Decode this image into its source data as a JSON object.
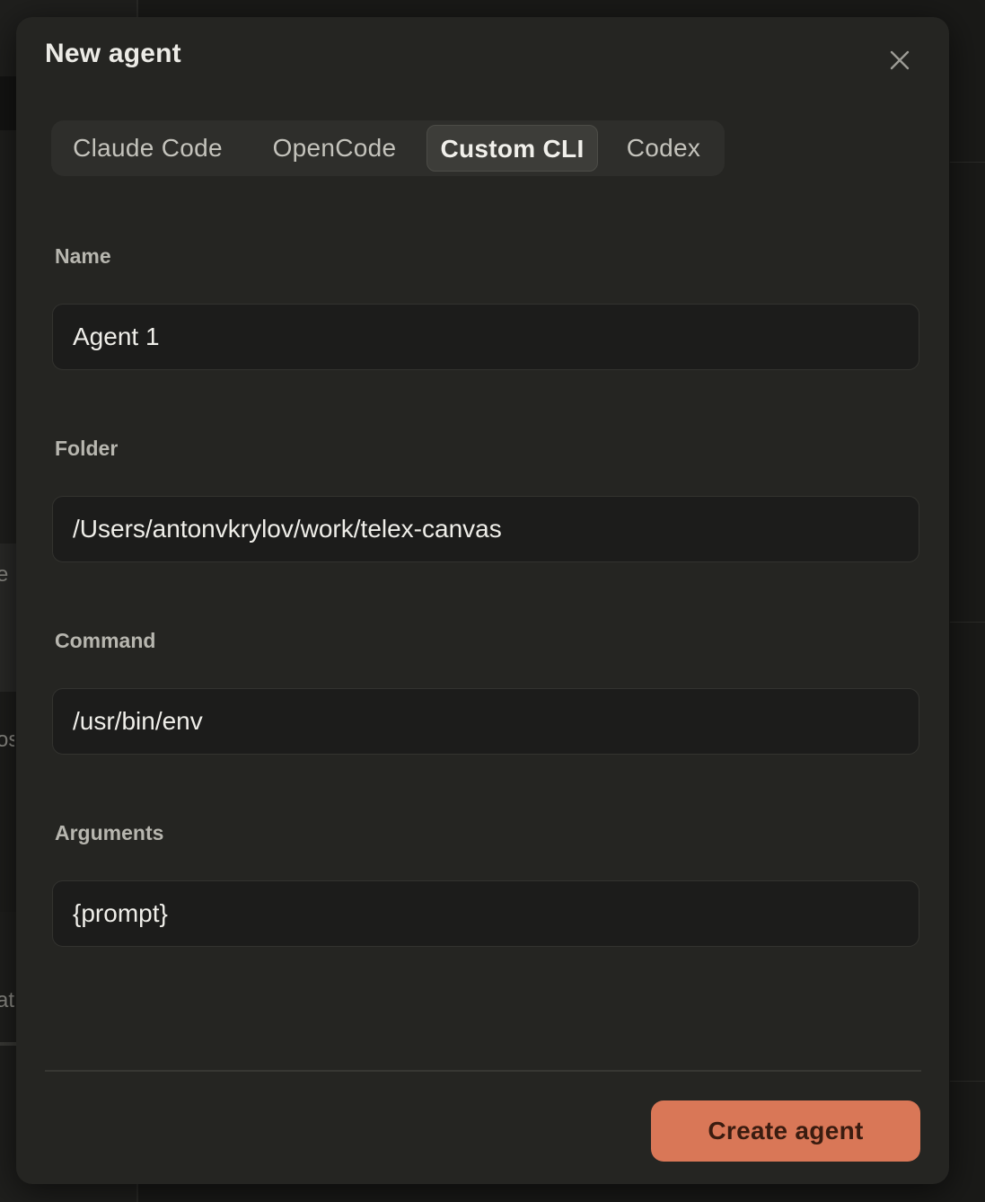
{
  "modal": {
    "title": "New agent",
    "close_icon": "close-icon"
  },
  "tabs": [
    {
      "label": "Claude Code",
      "active": false
    },
    {
      "label": "OpenCode",
      "active": false
    },
    {
      "label": "Custom CLI",
      "active": true
    },
    {
      "label": "Codex",
      "active": false
    }
  ],
  "fields": {
    "name": {
      "label": "Name",
      "value": "Agent 1"
    },
    "folder": {
      "label": "Folder",
      "value": "/Users/antonvkrylov/work/telex-canvas"
    },
    "command": {
      "label": "Command",
      "value": "/usr/bin/env"
    },
    "arguments": {
      "label": "Arguments",
      "value": "{prompt}"
    }
  },
  "footer": {
    "create_label": "Create agent"
  },
  "background": {
    "peek_1": "e",
    "peek_2": "os",
    "peek_3": "at"
  },
  "colors": {
    "accent": "#d97757",
    "modal_bg": "#252522",
    "input_bg": "#1c1c1b"
  }
}
